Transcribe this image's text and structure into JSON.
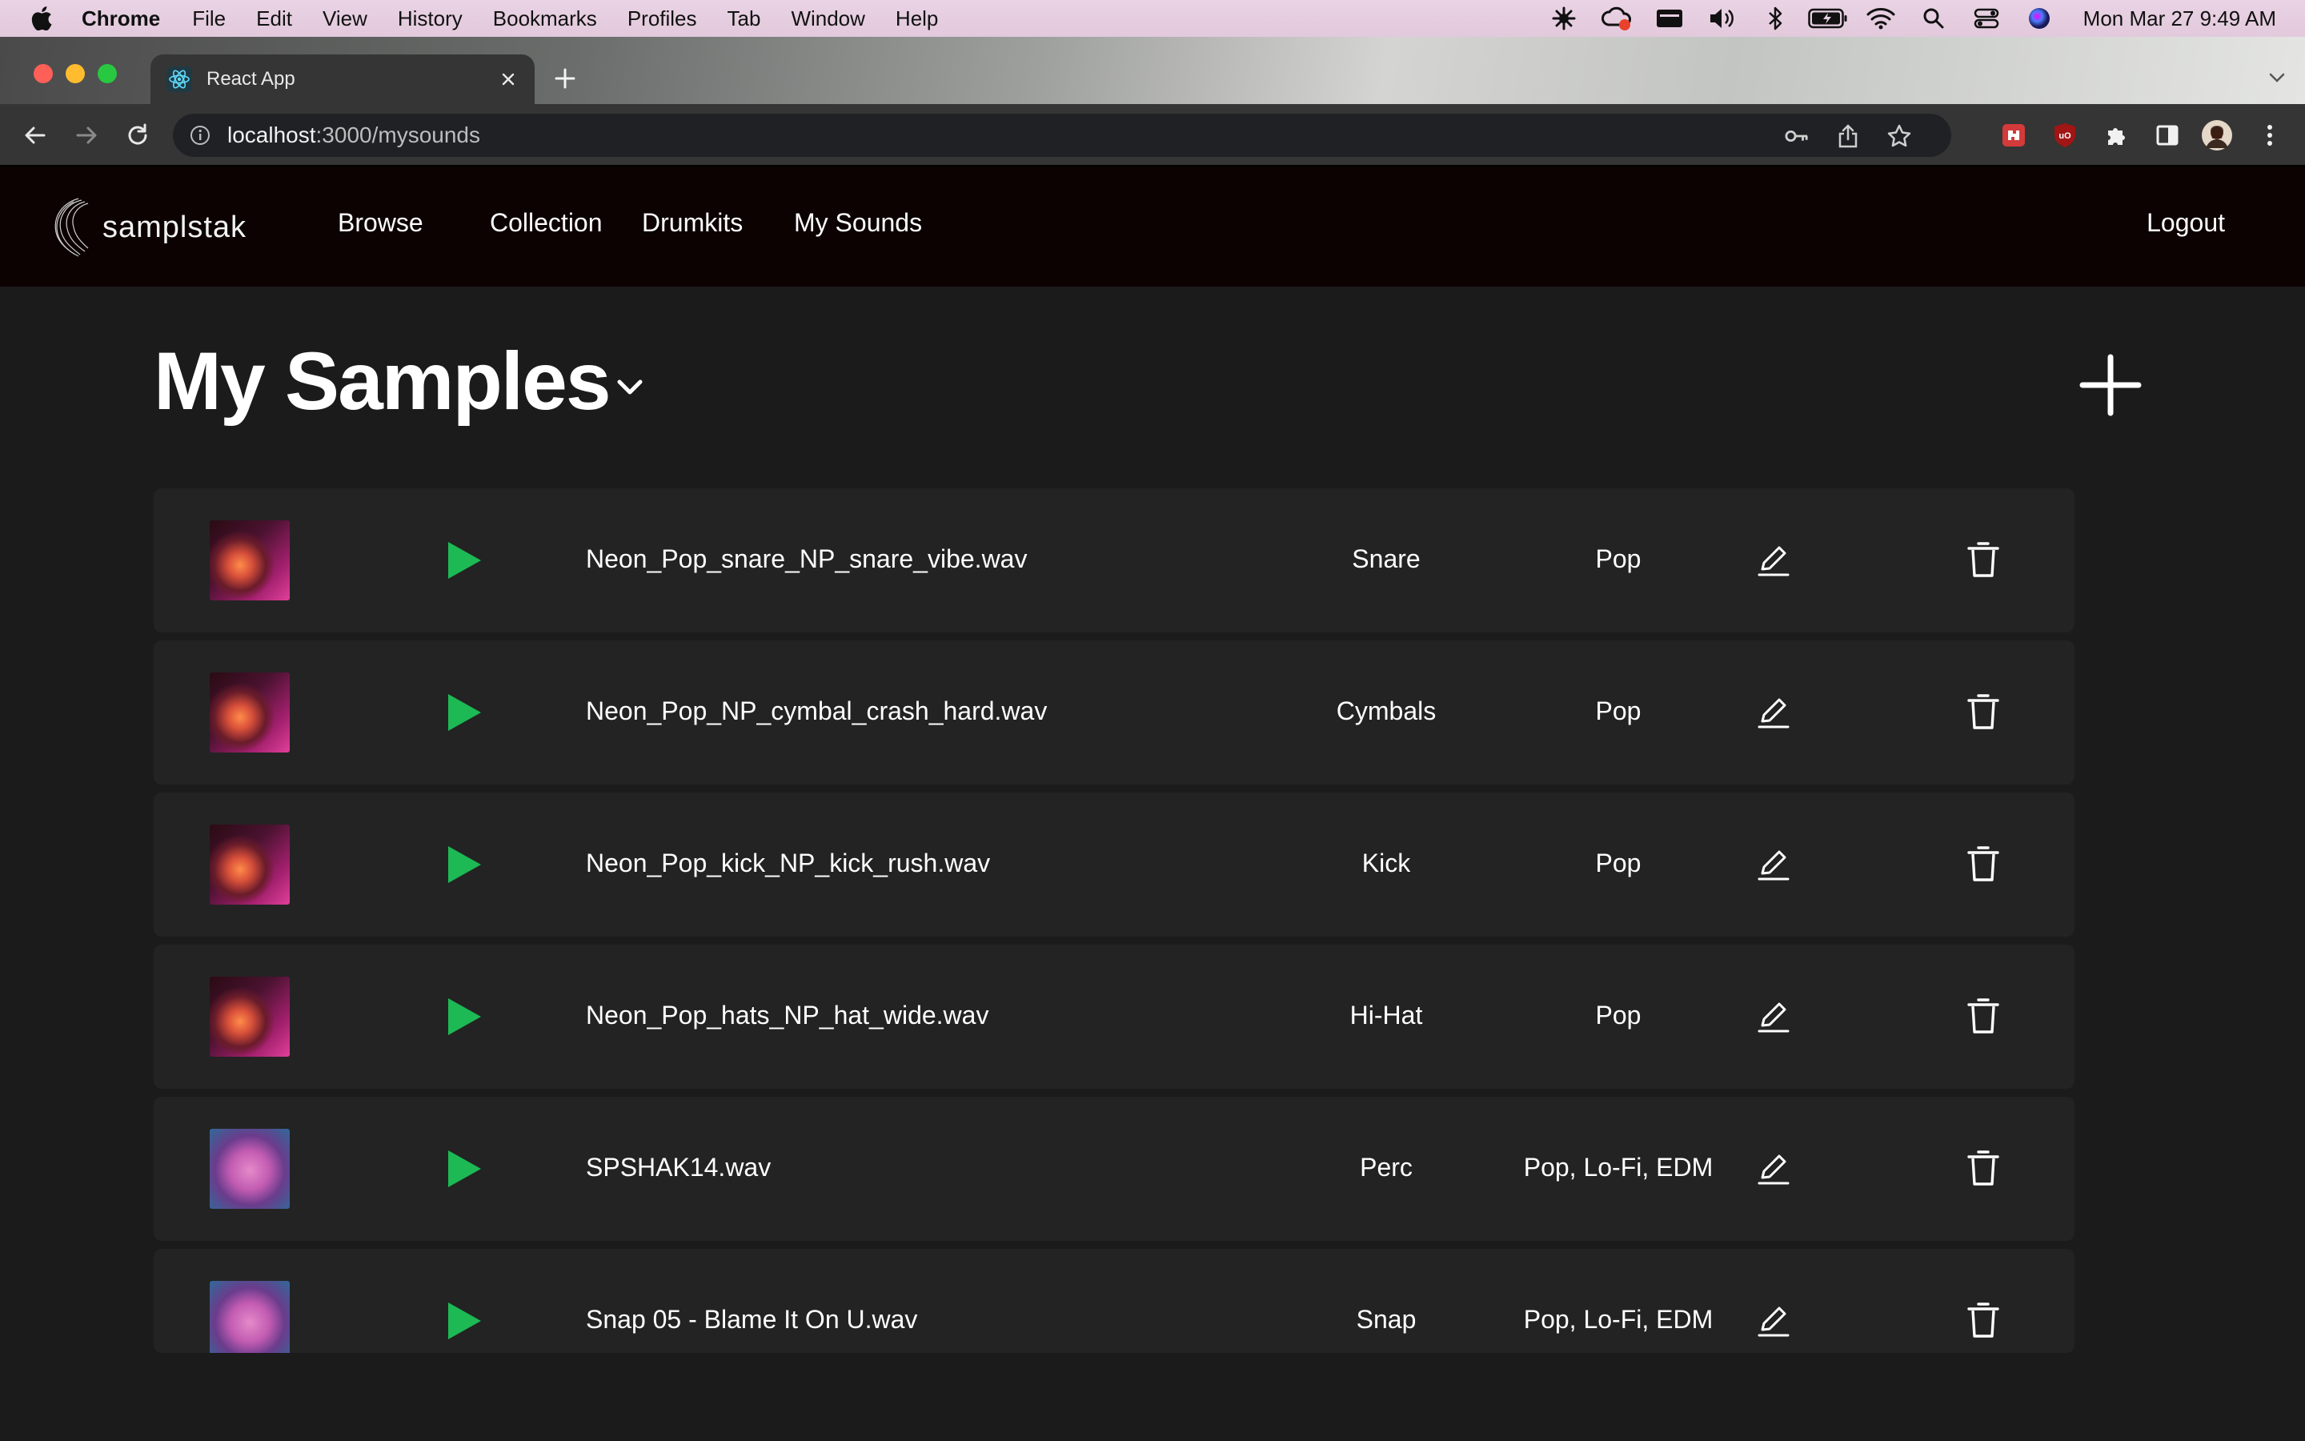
{
  "menubar": {
    "app_name": "Chrome",
    "menus": [
      "File",
      "Edit",
      "View",
      "History",
      "Bookmarks",
      "Profiles",
      "Tab",
      "Window",
      "Help"
    ],
    "clock": "Mon Mar 27  9:49 AM"
  },
  "browser": {
    "tab_title": "React App",
    "url_host": "localhost",
    "url_path": ":3000/mysounds"
  },
  "app": {
    "logo_text": "samplstak",
    "nav": {
      "browse": "Browse",
      "collection": "Collection",
      "drumkits": "Drumkits",
      "my_sounds": "My Sounds",
      "logout": "Logout"
    },
    "page_title": "My Samples"
  },
  "samples": [
    {
      "filename": "Neon_Pop_snare_NP_snare_vibe.wav",
      "category": "Snare",
      "genre": "Pop",
      "art": "neon"
    },
    {
      "filename": "Neon_Pop_NP_cymbal_crash_hard.wav",
      "category": "Cymbals",
      "genre": "Pop",
      "art": "neon"
    },
    {
      "filename": "Neon_Pop_kick_NP_kick_rush.wav",
      "category": "Kick",
      "genre": "Pop",
      "art": "neon"
    },
    {
      "filename": "Neon_Pop_hats_NP_hat_wide.wav",
      "category": "Hi-Hat",
      "genre": "Pop",
      "art": "neon"
    },
    {
      "filename": "SPSHAK14.wav",
      "category": "Perc",
      "genre": "Pop, Lo-Fi, EDM",
      "art": "face"
    },
    {
      "filename": "Snap 05 - Blame It On U.wav",
      "category": "Snap",
      "genre": "Pop, Lo-Fi, EDM",
      "art": "face"
    }
  ],
  "colors": {
    "play_green": "#1db954",
    "nav_background": "#0c0202",
    "row_background": "#232323",
    "page_background": "#1b1b1b"
  }
}
